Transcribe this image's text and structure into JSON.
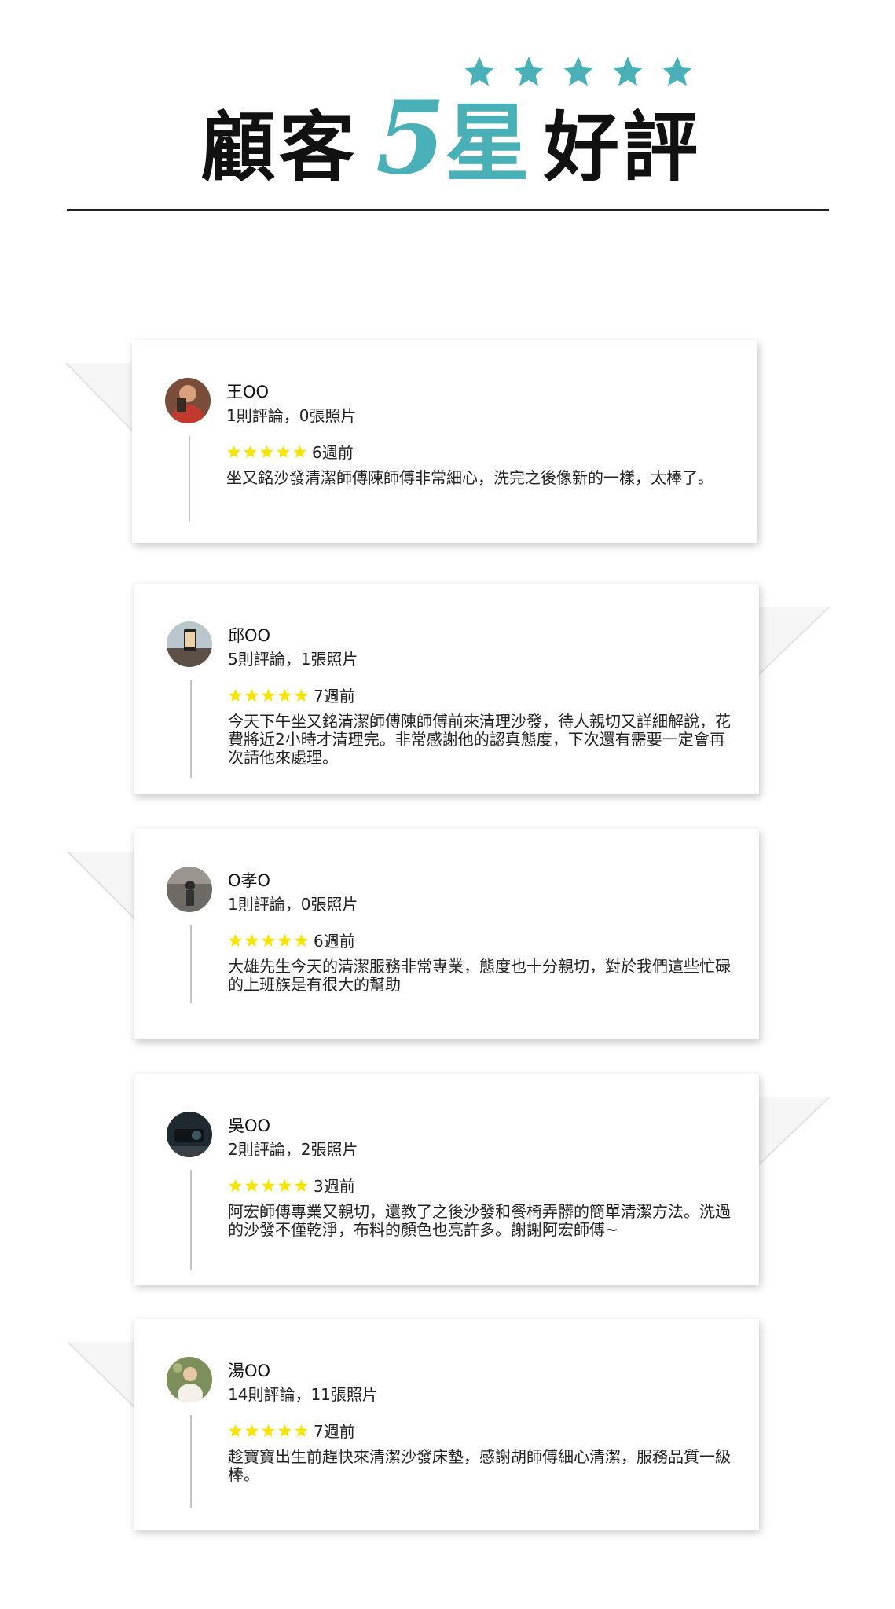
{
  "title": {
    "part1": "顧客",
    "part2": "5",
    "part3": "星",
    "part4": "好評",
    "star_count": 5,
    "star_color": "#49b0b7"
  },
  "rating_star_color": "#f5e400",
  "reviews": [
    {
      "name": "王OO",
      "meta": "1則評論，0張照片",
      "rating": 5,
      "time": "6週前",
      "text": "坐又銘沙發清潔師傅陳師傅非常細心，洗完之後像新的一樣，太棒了。"
    },
    {
      "name": "邱OO",
      "meta": "5則評論，1張照片",
      "rating": 5,
      "time": "7週前",
      "text": "今天下午坐又銘清潔師傅陳師傅前來清理沙發，待人親切又詳細解說，花費將近2小時才清理完。非常感謝他的認真態度，下次還有需要一定會再次請他來處理。"
    },
    {
      "name": "O孝O",
      "meta": "1則評論，0張照片",
      "rating": 5,
      "time": "6週前",
      "text": "大雄先生今天的清潔服務非常專業，態度也十分親切，對於我們這些忙碌的上班族是有很大的幫助"
    },
    {
      "name": "吳OO",
      "meta": "2則評論，2張照片",
      "rating": 5,
      "time": "3週前",
      "text": "阿宏師傅專業又親切，還教了之後沙發和餐椅弄髒的簡單清潔方法。洗過的沙發不僅乾淨，布料的顏色也亮許多。謝謝阿宏師傅~"
    },
    {
      "name": "湯OO",
      "meta": "14則評論，11張照片",
      "rating": 5,
      "time": "7週前",
      "text": "趁寶寶出生前趕快來清潔沙發床墊，感謝胡師傅細心清潔，服務品質一級棒。"
    }
  ]
}
